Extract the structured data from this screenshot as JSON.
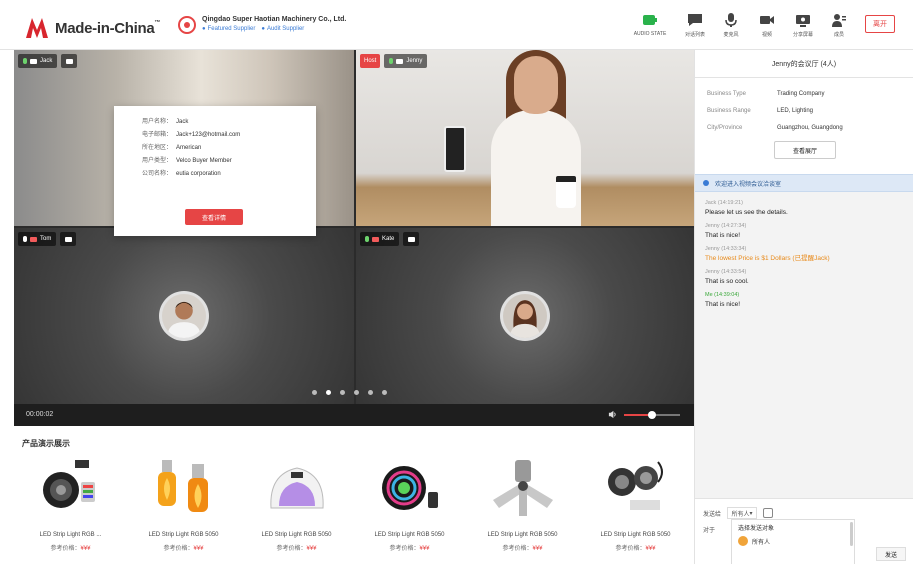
{
  "header": {
    "logo_text": "Made-in-China",
    "logo_tm": "™",
    "company_name": "Qingdao Super Haotian Machinery Co., Ltd.",
    "company_tags": [
      "Featured Supplier",
      "Audit Supplier"
    ],
    "tools": [
      {
        "label": "AUDIO STATE",
        "icon": "audio-state-icon"
      },
      {
        "label": "对话列表",
        "icon": "chat-icon"
      },
      {
        "label": "麦克风",
        "icon": "microphone-icon"
      },
      {
        "label": "视频",
        "icon": "video-camera-icon"
      },
      {
        "label": "分享屏幕",
        "icon": "screen-share-icon"
      },
      {
        "label": "成员",
        "icon": "members-icon"
      }
    ],
    "exit_label": "离开"
  },
  "videos": [
    {
      "name": "Jack",
      "host": false
    },
    {
      "name": "Jenny",
      "host": true,
      "host_label": "Host"
    },
    {
      "name": "Tom",
      "host": false
    },
    {
      "name": "Kate",
      "host": false
    }
  ],
  "popup": {
    "rows": [
      {
        "k": "用户名称：",
        "v": "Jack"
      },
      {
        "k": "电子邮箱：",
        "v": "Jack+123@hotmail.com"
      },
      {
        "k": "所在地区：",
        "v": "American"
      },
      {
        "k": "用户类型：",
        "v": "Velco Buyer Member"
      },
      {
        "k": "公司名称：",
        "v": "eutia corporation"
      }
    ],
    "button_label": "查看详情"
  },
  "controls": {
    "timer": "00:00:02",
    "dots": 6,
    "active_dot": 1,
    "volume_fraction": 0.5
  },
  "products": {
    "title": "产品演示展示",
    "items": [
      {
        "name": "LED Strip Light RGB ...",
        "price_label": "参考价格：",
        "price": "¥¥¥"
      },
      {
        "name": "LED Strip Light RGB 5050",
        "price_label": "参考价格：",
        "price": "¥¥¥"
      },
      {
        "name": "LED Strip Light RGB 5050",
        "price_label": "参考价格：",
        "price": "¥¥¥"
      },
      {
        "name": "LED Strip Light RGB 5050",
        "price_label": "参考价格：",
        "price": "¥¥¥"
      },
      {
        "name": "LED Strip Light RGB 5050",
        "price_label": "参考价格：",
        "price": "¥¥¥"
      },
      {
        "name": "LED Strip Light RGB 5050",
        "price_label": "参考价格：",
        "price": "¥¥¥"
      }
    ]
  },
  "sidebar": {
    "title": "Jenny的会议厅 (4人)",
    "info": [
      {
        "k": "Business Type",
        "v": "Trading Company"
      },
      {
        "k": "Business Range",
        "v": "LED, Lighting"
      },
      {
        "k": "City/Province",
        "v": "Guangzhou, Guangdong"
      }
    ],
    "button_label": "查看展厅",
    "notice": "欢迎进入视频会议洽谈室",
    "messages": [
      {
        "who": "Jack (14:19:21)",
        "text": "Please let us see the details.",
        "who_style": "",
        "text_style": ""
      },
      {
        "who": "Jenny (14:27:34)",
        "text": "That is nice!",
        "who_style": "",
        "text_style": ""
      },
      {
        "who": "Jenny (14:33:34)",
        "text": "The lowest Price is $1 Dollars (已提醒Jack)",
        "who_style": "",
        "text_style": "orange"
      },
      {
        "who": "Jenny (14:33:54)",
        "text": "That is so cool.",
        "who_style": "",
        "text_style": ""
      },
      {
        "who": "Me (14:39:04)",
        "text": "That is nice!",
        "who_style": "green",
        "text_style": ""
      }
    ],
    "input": {
      "send_to_label": "发送给",
      "select_value": "所有人",
      "to_label": "对于",
      "list_items": [
        "选择发送对象",
        "所有人"
      ],
      "send_label": "发送"
    }
  }
}
